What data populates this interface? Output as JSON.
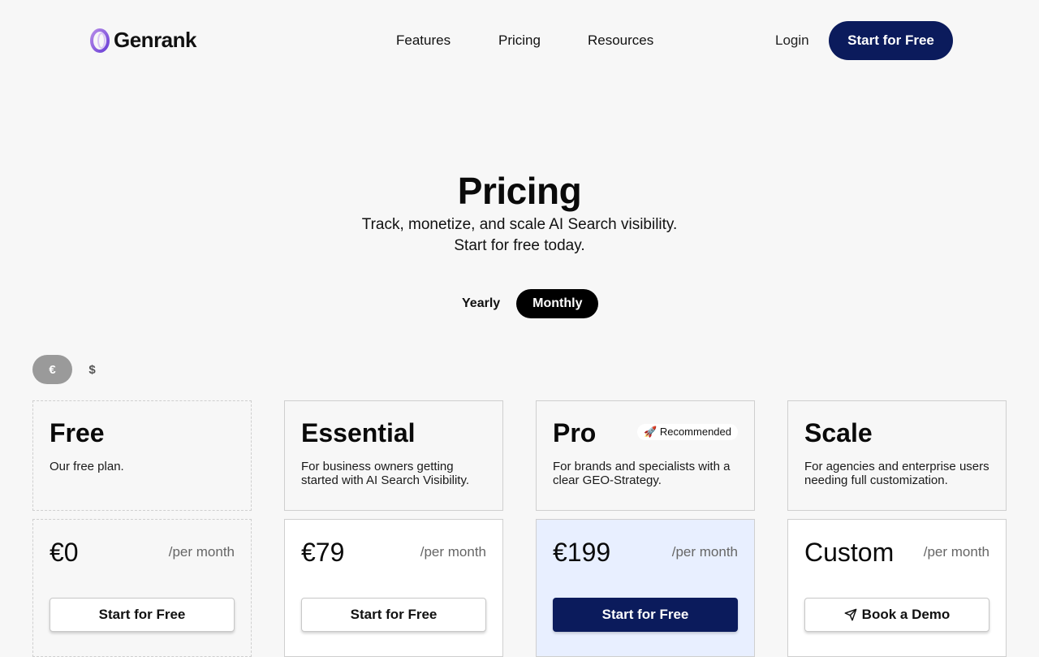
{
  "brand": {
    "name": "Genrank",
    "logo_icon": "genrank-logo-icon"
  },
  "nav": {
    "links": [
      "Features",
      "Pricing",
      "Resources"
    ],
    "login": "Login",
    "cta": "Start for Free"
  },
  "hero": {
    "title": "Pricing",
    "subtitle_line1": "Track, monetize, and scale AI Search visibility.",
    "subtitle_line2": "Start for free today."
  },
  "billing": {
    "options": [
      "Yearly",
      "Monthly"
    ],
    "selected": "Monthly"
  },
  "currency": {
    "options": [
      "€",
      "$"
    ],
    "selected": "€"
  },
  "plans": [
    {
      "name": "Free",
      "description": "Our free plan.",
      "price": "€0",
      "period": "/per month",
      "button": "Start for Free"
    },
    {
      "name": "Essential",
      "description": "For business owners getting started with AI Search Visibility.",
      "price": "€79",
      "period": "/per month",
      "button": "Start for Free"
    },
    {
      "name": "Pro",
      "badge": "🚀 Recommended",
      "description": "For brands and specialists with a clear GEO-Strategy.",
      "price": "€199",
      "period": "/per month",
      "button": "Start for Free"
    },
    {
      "name": "Scale",
      "description": "For agencies and enterprise users needing full customization.",
      "price": "Custom",
      "period": "/per month",
      "button": "Book a Demo",
      "button_icon": "paper-plane-icon"
    }
  ],
  "colors": {
    "primary": "#0b1b5c",
    "highlight_card": "#e8efff",
    "background": "#f7f7f7"
  }
}
